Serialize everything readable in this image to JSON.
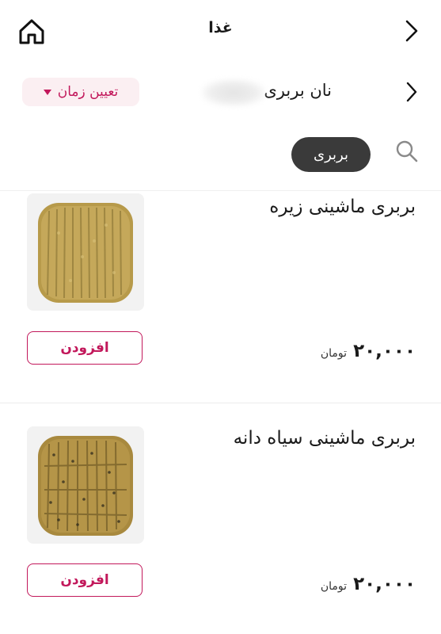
{
  "header": {
    "title": "غذا",
    "back_icon": "chevron-right-icon",
    "home_icon": "home-icon"
  },
  "store": {
    "name": "نان بربری",
    "time_button_label": "تعیین زمان"
  },
  "filter": {
    "search_icon": "search-icon",
    "active_category": "بربری"
  },
  "products": [
    {
      "name": "بربری ماشینی زیره",
      "price": "۲۰,۰۰۰",
      "currency": "تومان",
      "add_label": "افزودن"
    },
    {
      "name": "بربری ماشینی سیاه دانه",
      "price": "۲۰,۰۰۰",
      "currency": "تومان",
      "add_label": "افزودن"
    }
  ],
  "colors": {
    "accent": "#c2185b",
    "accent_bg": "#fbeff2",
    "chip_bg": "#3a3a3a"
  }
}
